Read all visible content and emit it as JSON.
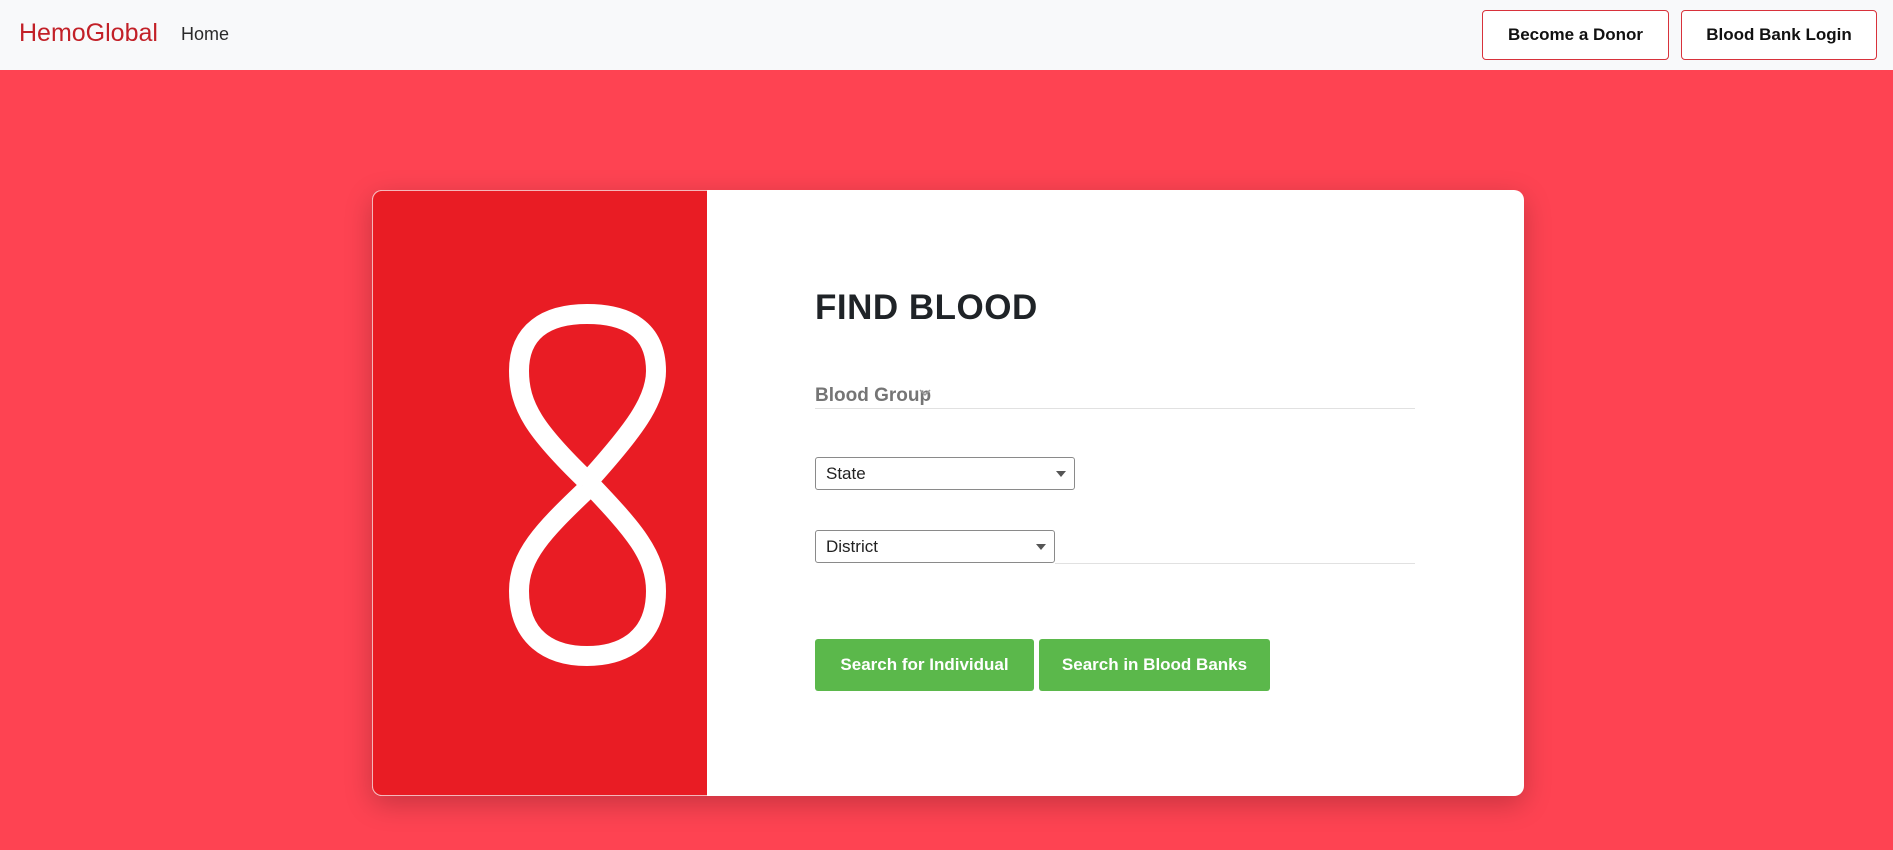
{
  "navbar": {
    "brand": "HemoGlobal",
    "home_link": "Home",
    "become_donor_label": "Become a Donor",
    "blood_bank_login_label": "Blood Bank Login"
  },
  "search_card": {
    "title": "FIND BLOOD",
    "blood_group_label": "Blood Group",
    "state_select": {
      "selected": "State"
    },
    "district_select": {
      "selected": "District"
    },
    "search_individual_label": "Search for Individual",
    "search_banks_label": "Search in Blood Banks"
  },
  "colors": {
    "page_background": "#fe4352",
    "brand": "#c22027",
    "hero_panel": "#e91c24",
    "primary_button": "#5bb84b",
    "nav_button_border": "#d8323b"
  },
  "icons": [
    "blood-drop-loop-icon",
    "chevron-down-icon",
    "dropdown-arrow-icon"
  ]
}
